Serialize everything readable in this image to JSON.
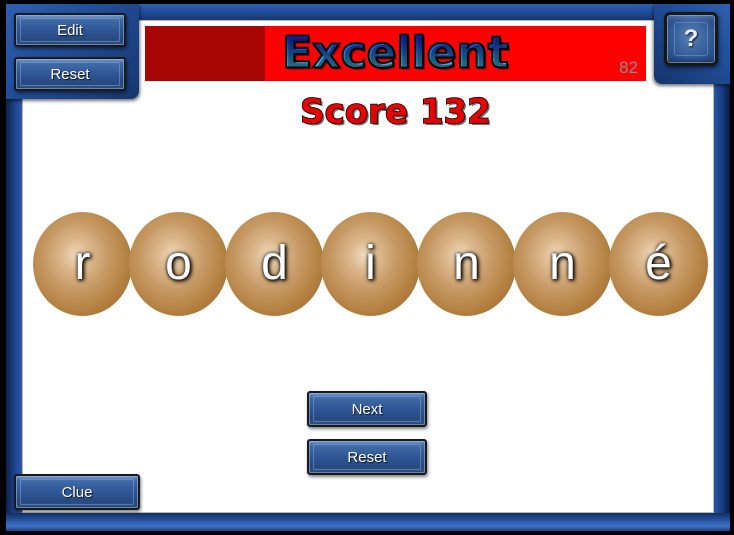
{
  "window": {
    "background": "#000000",
    "frame_color": "#22509e",
    "sheet_color": "#ffffff"
  },
  "toolbar": {
    "edit_label": "Edit",
    "reset_label": "Reset",
    "help_label": "?"
  },
  "progress": {
    "rating_text": "Excellent",
    "value_text": "82",
    "value": 82,
    "max": 100,
    "fill_percent": 24,
    "track_color": "#ff0000",
    "fill_color": "#a80505",
    "value_color": "#8c8c8c",
    "rating_gradient_top": "#0a12c8",
    "rating_gradient_bottom": "#7fe7f4"
  },
  "score": {
    "label": "Score 132",
    "value": 132,
    "color": "#e60000"
  },
  "puzzle": {
    "word": "rodinné",
    "letters": [
      {
        "char": "r"
      },
      {
        "char": "o"
      },
      {
        "char": "d"
      },
      {
        "char": "i"
      },
      {
        "char": "n"
      },
      {
        "char": "n"
      },
      {
        "char": "é"
      }
    ],
    "ball_color": "#b3803f",
    "letter_color": "#ffffff"
  },
  "actions": {
    "next_label": "Next",
    "reset_label": "Reset",
    "clue_label": "Clue"
  }
}
